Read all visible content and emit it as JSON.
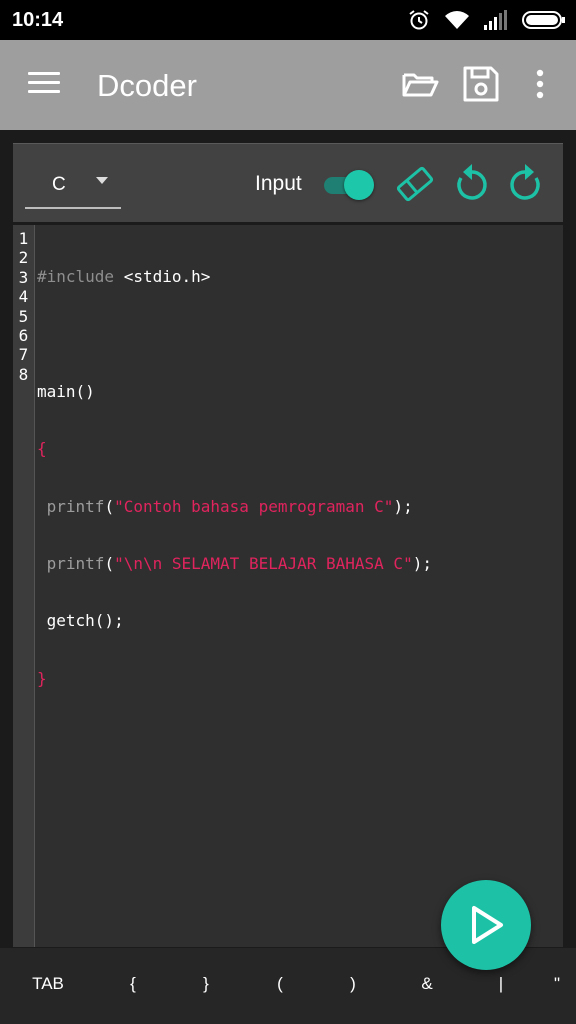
{
  "status_bar": {
    "time": "10:14",
    "icons": [
      "alarm-icon",
      "wifi-icon",
      "signal-icon",
      "battery-icon"
    ]
  },
  "app_bar": {
    "title": "Dcoder",
    "actions": [
      "folder-open-icon",
      "save-icon",
      "more-vert-icon"
    ]
  },
  "toolbar": {
    "language": "C",
    "input_label": "Input",
    "input_toggle_on": true,
    "icons": [
      "eraser-icon",
      "undo-icon",
      "redo-icon"
    ]
  },
  "editor": {
    "line_numbers": [
      "1",
      "2",
      "3",
      "4",
      "5",
      "6",
      "7",
      "8"
    ],
    "code": {
      "l1_pre": "#include",
      "l1_rest": " <stdio.h>",
      "l3": "main()",
      "l4": "{",
      "l5_fn": " printf",
      "l5_open": "(",
      "l5_str": "\"Contoh bahasa pemrograman C\"",
      "l5_close": ");",
      "l6_fn": " printf",
      "l6_open": "(",
      "l6_str": "\"\\n\\n SELAMAT BELAJAR BAHASA C\"",
      "l6_close": ");",
      "l7": " getch();",
      "l8": "}"
    }
  },
  "run_button": {
    "icon": "play-icon"
  },
  "key_bar": {
    "keys": [
      "TAB",
      "{",
      "}",
      "(",
      ")",
      "&",
      "|",
      "\""
    ]
  },
  "colors": {
    "accent": "#1dc2a6",
    "app_bar": "#9e9e9e",
    "string": "#e0245e",
    "editor_bg": "#2f2f2f"
  }
}
